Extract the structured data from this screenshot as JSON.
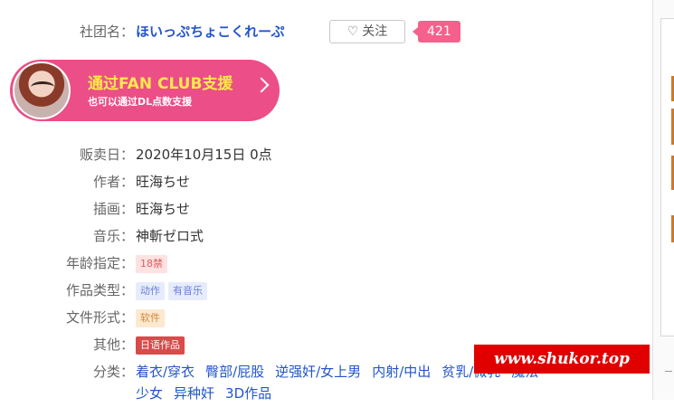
{
  "circle": {
    "label": "社团名：",
    "name": "ほいっぷちょこくれーぷ",
    "follow_icon": "heart-outline-icon",
    "follow_label": "关注",
    "follow_count": "421"
  },
  "fanclub": {
    "title": "通过FAN CLUB支援",
    "subtitle": "也可以通过DL点数支援",
    "arrow_icon": "chevron-right-icon"
  },
  "info": {
    "release": {
      "label": "贩卖日：",
      "value": "2020年10月15日 0点"
    },
    "author": {
      "label": "作者：",
      "value": "旺海ちせ"
    },
    "illust": {
      "label": "插画：",
      "value": "旺海ちせ"
    },
    "music": {
      "label": "音乐：",
      "value": "神斬ゼロ式"
    },
    "age": {
      "label": "年龄指定：",
      "tag": "18禁"
    },
    "type": {
      "label": "作品类型：",
      "tags": [
        "动作",
        "有音乐"
      ]
    },
    "format": {
      "label": "文件形式：",
      "tag": "软件"
    },
    "other": {
      "label": "其他：",
      "tag": "日语作品"
    },
    "genre": {
      "label": "分类：",
      "line1": [
        "着衣/穿衣",
        "臀部/屁股",
        "逆强奸/女上男",
        "内射/中出",
        "贫乳/微乳",
        "魔法"
      ],
      "line2": [
        "少女",
        "异种奸",
        "3D作品"
      ]
    }
  },
  "watermark": "www.shukor.top",
  "colors": {
    "link": "#2255cc",
    "fanclub_bg": "#ec4e87",
    "fanclub_title": "#ffe94a",
    "count_badge": "#f6608c",
    "watermark_bg": "#e10000"
  }
}
